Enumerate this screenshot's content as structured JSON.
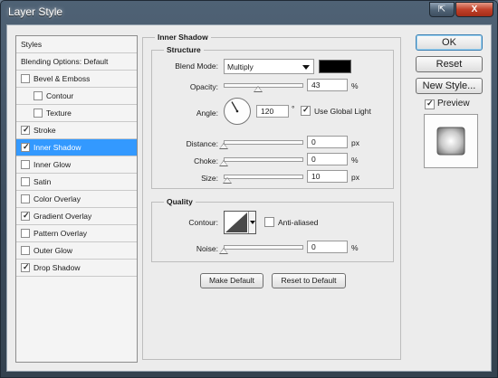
{
  "window": {
    "title": "Layer Style",
    "help_icon": "help-arrow-icon",
    "close_icon": "close-x-icon",
    "help_glyph": "⇱",
    "close_glyph": "X"
  },
  "styles_list": {
    "header": "Styles",
    "blending": "Blending Options: Default",
    "items": [
      {
        "label": "Bevel & Emboss",
        "checked": false
      },
      {
        "label": "Contour",
        "checked": false
      },
      {
        "label": "Texture",
        "checked": false
      },
      {
        "label": "Stroke",
        "checked": true
      },
      {
        "label": "Inner Shadow",
        "checked": true
      },
      {
        "label": "Inner Glow",
        "checked": false
      },
      {
        "label": "Satin",
        "checked": false
      },
      {
        "label": "Color Overlay",
        "checked": false
      },
      {
        "label": "Gradient Overlay",
        "checked": true
      },
      {
        "label": "Pattern Overlay",
        "checked": false
      },
      {
        "label": "Outer Glow",
        "checked": false
      },
      {
        "label": "Drop Shadow",
        "checked": true
      }
    ],
    "selected": "Inner Shadow",
    "check_glyph": "✓"
  },
  "inner_shadow": {
    "title": "Inner Shadow",
    "structure": {
      "title": "Structure",
      "blend_mode_label": "Blend Mode:",
      "blend_mode_value": "Multiply",
      "shadow_color": "#000000",
      "opacity_label": "Opacity:",
      "opacity_value": "43",
      "opacity_unit": "%",
      "opacity_level": 0.43,
      "angle_label": "Angle:",
      "angle_value": "120",
      "angle_unit": "°",
      "global_light_label": "Use Global Light",
      "global_light_checked": true,
      "distance_label": "Distance:",
      "distance_value": "0",
      "distance_unit": "px",
      "distance_level": 0,
      "choke_label": "Choke:",
      "choke_value": "0",
      "choke_unit": "%",
      "choke_level": 0,
      "size_label": "Size:",
      "size_value": "10",
      "size_unit": "px",
      "size_level": 0.04
    },
    "quality": {
      "title": "Quality",
      "contour_label": "Contour:",
      "anti_aliased_label": "Anti-aliased",
      "anti_aliased_checked": false,
      "noise_label": "Noise:",
      "noise_value": "0",
      "noise_unit": "%",
      "noise_level": 0
    },
    "make_default": "Make Default",
    "reset_to_default": "Reset to Default"
  },
  "actions": {
    "ok": "OK",
    "reset": "Reset",
    "new_style": "New Style...",
    "preview_label": "Preview",
    "preview_checked": true
  }
}
